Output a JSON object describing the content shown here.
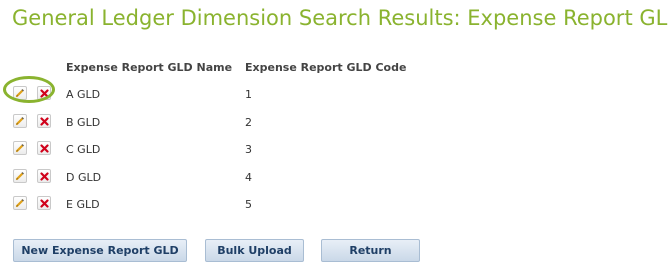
{
  "page": {
    "title": "General Ledger Dimension Search Results: Expense Report GLD"
  },
  "table": {
    "columns": [
      "Expense Report GLD Name",
      "Expense Report GLD Code"
    ],
    "rows": [
      {
        "name": "A GLD",
        "code": "1"
      },
      {
        "name": "B GLD",
        "code": "2"
      },
      {
        "name": "C GLD",
        "code": "3"
      },
      {
        "name": "D GLD",
        "code": "4"
      },
      {
        "name": "E GLD",
        "code": "5"
      }
    ]
  },
  "row_actions": {
    "edit_icon": "pencil-icon",
    "delete_icon": "red-x-icon"
  },
  "buttons": {
    "new_label": "New Expense Report GLD",
    "bulk_upload_label": "Bulk Upload",
    "return_label": "Return"
  },
  "colors": {
    "title": "#8ab32f",
    "highlight": "#8ab32f",
    "delete": "#d0021b",
    "button_text": "#1f3f66"
  }
}
